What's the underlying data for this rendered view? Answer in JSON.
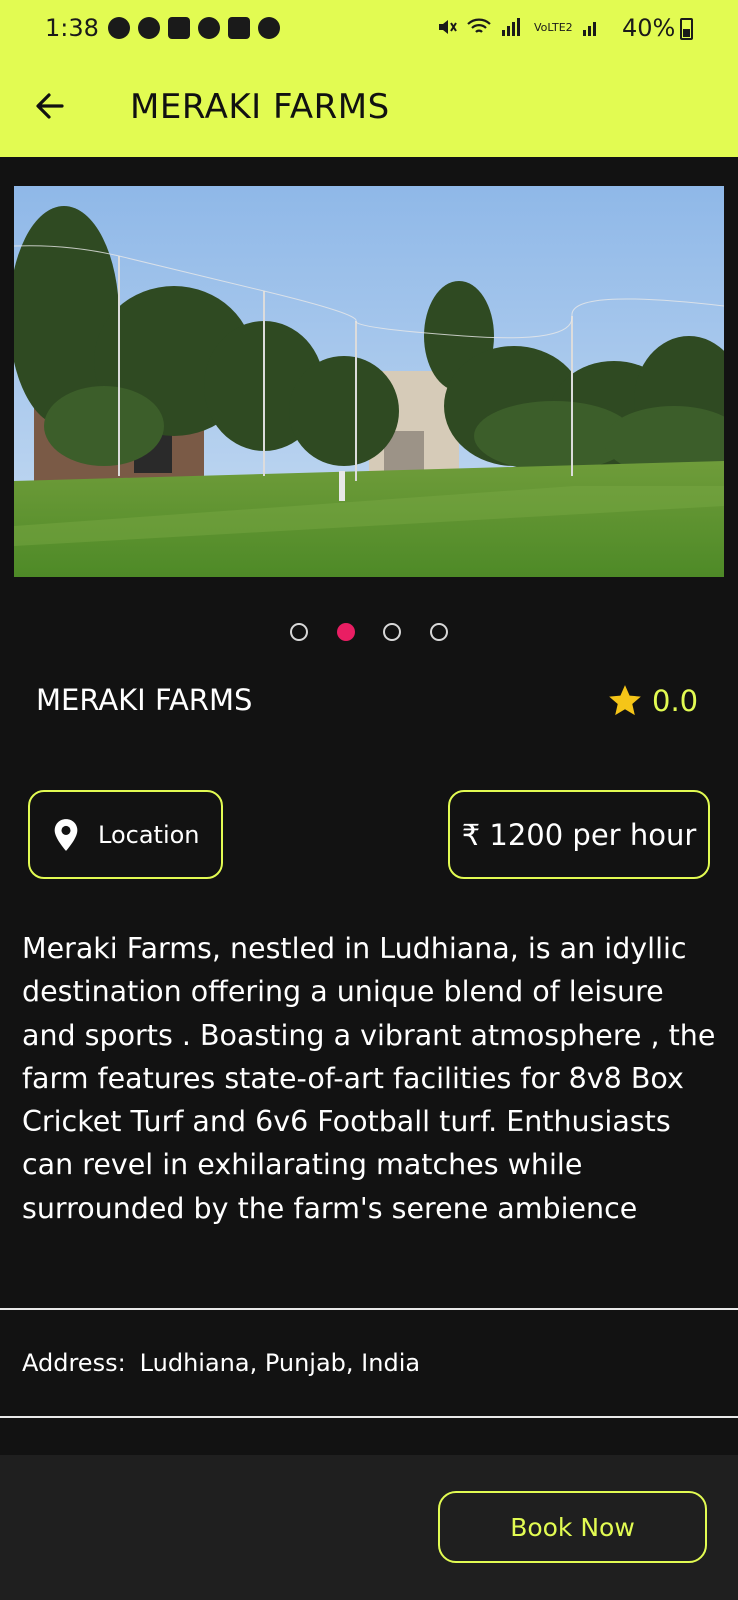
{
  "status_bar": {
    "time": "1:38",
    "battery": "40%",
    "network_label": "VoLTE2"
  },
  "app_bar": {
    "title": "MERAKI FARMS",
    "back_icon": "arrow-left-icon"
  },
  "carousel": {
    "image_alt": "Cricket turf with nets and trees",
    "page_count": 4,
    "active_index": 1
  },
  "venue": {
    "name": "MERAKI FARMS",
    "rating": "0.0",
    "rating_icon": "star-icon"
  },
  "chips": {
    "location_label": "Location",
    "location_icon": "map-pin-icon",
    "price_label": "₹ 1200 per hour"
  },
  "description": "Meraki Farms, nestled in Ludhiana, is an idyllic destination offering a unique blend of leisure and sports . Boasting a vibrant atmosphere , the farm features state-of-art facilities for 8v8 Box Cricket Turf and 6v6 Football turf. Enthusiasts can revel in exhilarating matches while surrounded by the farm's serene ambience",
  "address": {
    "label": "Address:",
    "value": "Ludhiana, Punjab, India"
  },
  "actions": {
    "book_now": "Book Now"
  },
  "colors": {
    "accent": "#e2fb52",
    "background": "#121212",
    "dot_active": "#e91e63",
    "star": "#f5c518"
  }
}
